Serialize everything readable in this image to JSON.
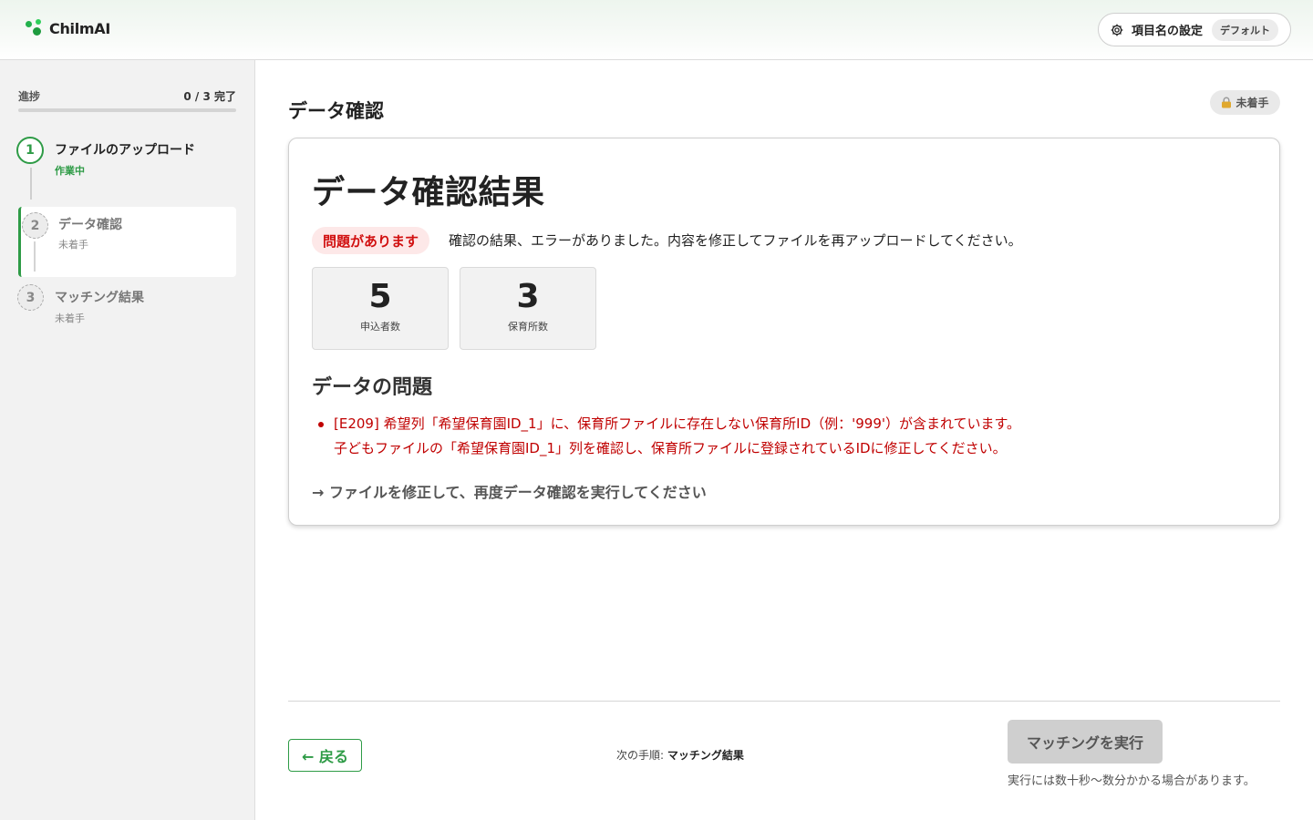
{
  "app": {
    "brand": "ChilmAI"
  },
  "header": {
    "settings_label": "項目名の設定",
    "settings_badge": "デフォルト",
    "settings_icon": "gear-icon"
  },
  "sidebar": {
    "progress_label": "進捗",
    "progress_count": "0 / 3 完了",
    "progress_fraction": 0,
    "steps": [
      {
        "number": "1",
        "title": "ファイルのアップロード",
        "status": "作業中"
      },
      {
        "number": "2",
        "title": "データ確認",
        "status": "未着手"
      },
      {
        "number": "3",
        "title": "マッチング結果",
        "status": "未着手"
      }
    ]
  },
  "main": {
    "page_title": "データ確認",
    "status_pill": "未着手",
    "status_icon": "lock-icon",
    "card": {
      "title": "データ確認結果",
      "issue_badge": "問題があります",
      "issue_message": "確認の結果、エラーがありました。内容を修正してファイルを再アップロードしてください。",
      "stats": [
        {
          "value": "5",
          "label": "申込者数"
        },
        {
          "value": "3",
          "label": "保育所数"
        }
      ],
      "section_title": "データの問題",
      "errors": [
        {
          "line1": "[E209] 希望列「希望保育園ID_1」に、保育所ファイルに存在しない保育所ID（例：'999'）が含まれています。",
          "line2": "子どもファイルの「希望保育園ID_1」列を確認し、保育所ファイルに登録されているIDに修正してください。"
        }
      ],
      "next_hint": "→ ファイルを修正して、再度データ確認を実行してください"
    }
  },
  "footer": {
    "back_label": "← 戻る",
    "next_step_prefix": "次の手順:",
    "next_step_name": "マッチング結果",
    "run_label": "マッチングを実行",
    "run_note": "実行には数十秒〜数分かかる場合があります。"
  },
  "colors": {
    "accent": "#2e9b46",
    "error": "#c00000",
    "error_badge_bg": "#fde8e8",
    "error_badge_text": "#d10f0f"
  }
}
